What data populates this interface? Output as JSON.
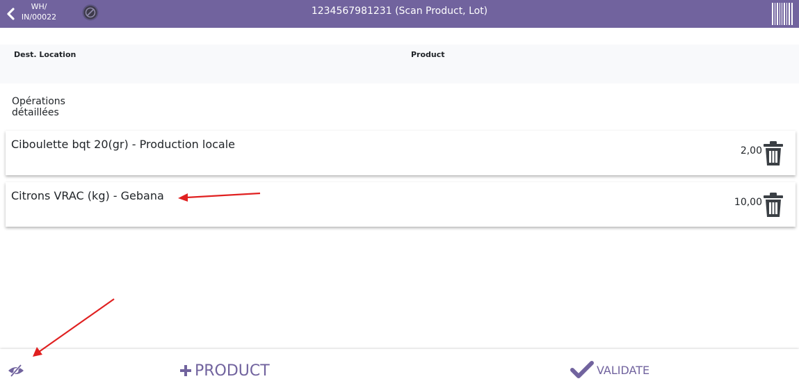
{
  "header": {
    "back_icon": "chevron-left-icon",
    "doc_ref_line1": "WH/",
    "doc_ref_line2": "IN/00022",
    "no_package_icon": "no-package-icon",
    "title": "1234567981231 (Scan Product, Lot)",
    "barcode_icon": "barcode-icon",
    "bar_color": "#71639e"
  },
  "info": {
    "dest_location_label": "Dest. Location",
    "product_label": "Product"
  },
  "section": {
    "title": "Opérations détaillées"
  },
  "lines": [
    {
      "name": "Ciboulette bqt 20(gr) - Production locale",
      "quantity": "2,00"
    },
    {
      "name": "Citrons VRAC (kg) - Gebana",
      "quantity": "10,00"
    }
  ],
  "footer": {
    "eye_icon": "eye-slash-icon",
    "add_product_label": "PRODUCT",
    "validate_label": "VALIDATE",
    "accent_color": "#71639e"
  },
  "annotations": {
    "arrow_color": "#e02020"
  }
}
